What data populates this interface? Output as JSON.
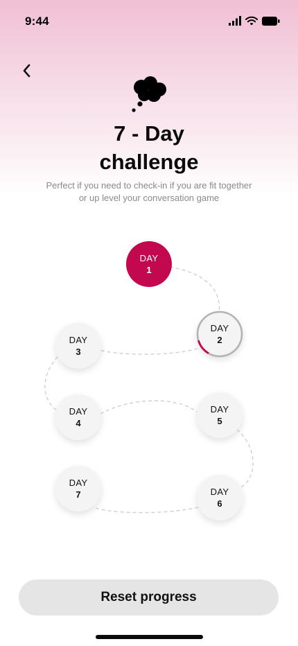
{
  "status_bar": {
    "time": "9:44",
    "icons": [
      "signal-icon",
      "wifi-icon",
      "battery-icon"
    ]
  },
  "header": {
    "back_icon": "chevron-left-icon",
    "illustration_icon": "thought-bubble-icon",
    "title_line1": "7 - Day",
    "title_line2": "challenge",
    "subtitle_line1": "Perfect if you need to check-in if you are fit together",
    "subtitle_line2": "or up level your conversation game"
  },
  "days": [
    {
      "label": "DAY",
      "number": "1",
      "state": "completed"
    },
    {
      "label": "DAY",
      "number": "2",
      "state": "in-progress",
      "progress": 0.12
    },
    {
      "label": "DAY",
      "number": "3",
      "state": "locked"
    },
    {
      "label": "DAY",
      "number": "4",
      "state": "locked"
    },
    {
      "label": "DAY",
      "number": "5",
      "state": "locked"
    },
    {
      "label": "DAY",
      "number": "6",
      "state": "locked"
    },
    {
      "label": "DAY",
      "number": "7",
      "state": "locked"
    }
  ],
  "actions": {
    "reset_label": "Reset progress"
  },
  "colors": {
    "accent": "#c2084e",
    "node_bg": "#f4f4f4",
    "button_bg": "#e5e5e5",
    "path": "#cfcfcf"
  }
}
